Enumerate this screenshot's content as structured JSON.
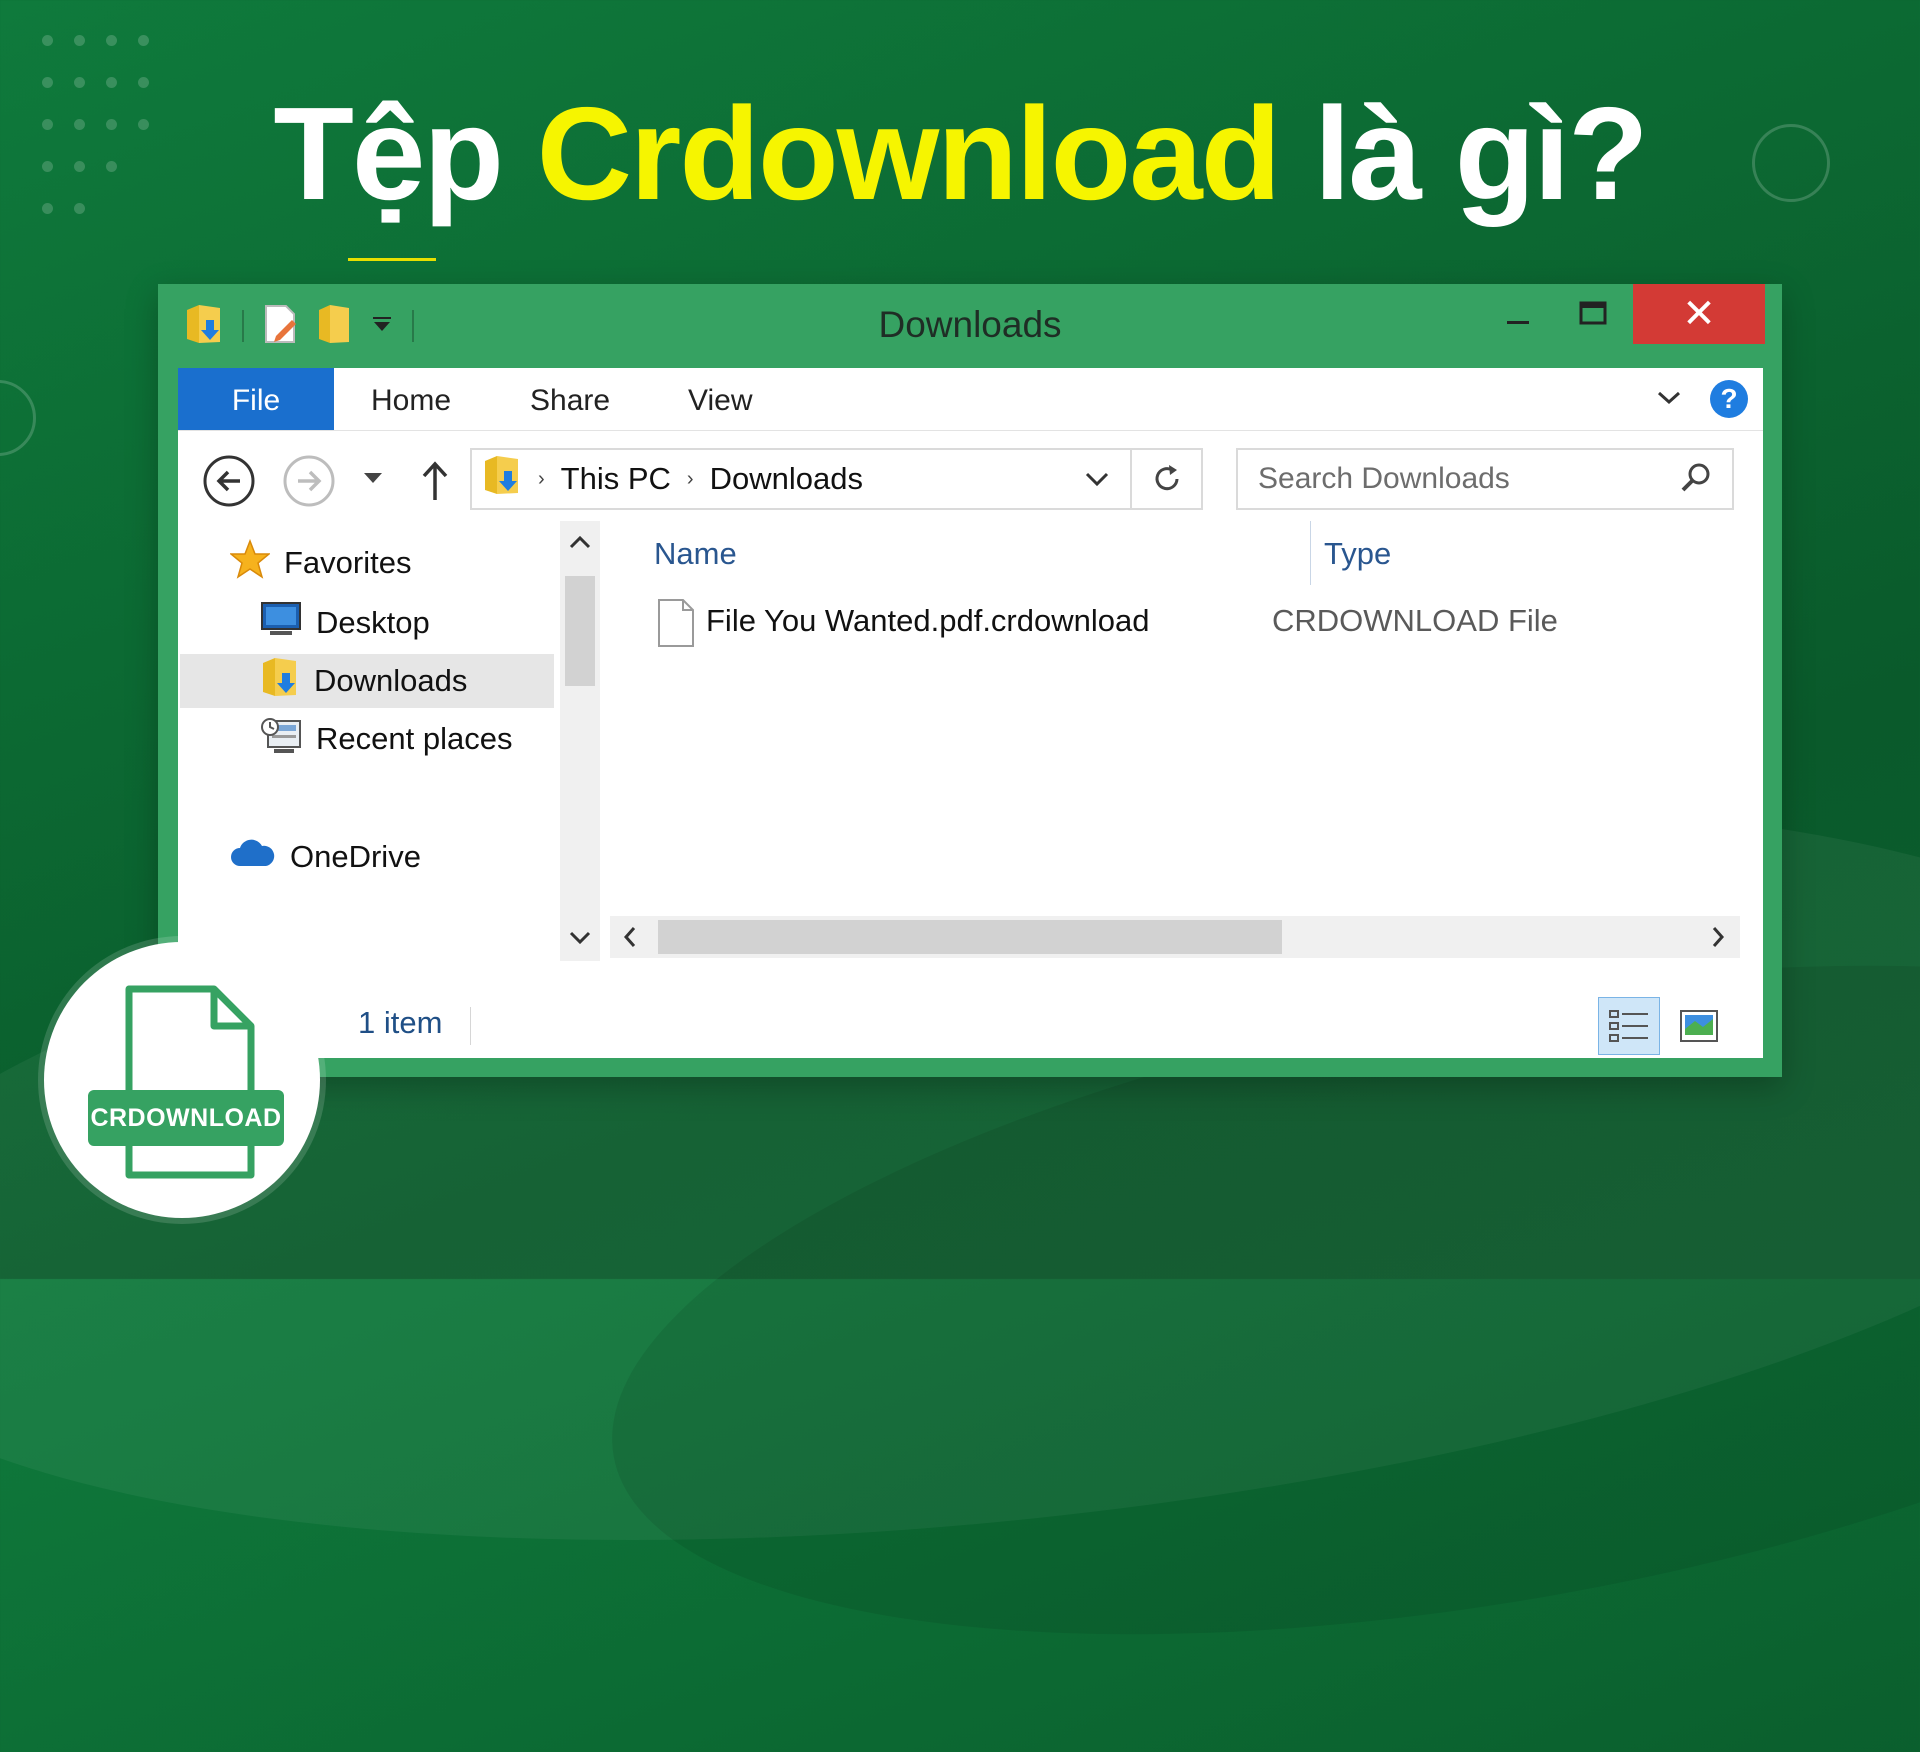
{
  "headline": {
    "part1": "Tệp ",
    "highlight": "Crdownload",
    "part2": " là gì?"
  },
  "window": {
    "title": "Downloads",
    "close_glyph": "✕"
  },
  "ribbon": {
    "tabs": [
      "File",
      "Home",
      "Share",
      "View"
    ],
    "help_glyph": "?"
  },
  "address": {
    "crumbs": [
      "This PC",
      "Downloads"
    ],
    "separator": "›"
  },
  "search": {
    "placeholder": "Search Downloads"
  },
  "nav": {
    "favorites": "Favorites",
    "items": [
      "Desktop",
      "Downloads",
      "Recent places"
    ],
    "onedrive": "OneDrive"
  },
  "columns": {
    "name": "Name",
    "type": "Type"
  },
  "files": [
    {
      "name": "File You Wanted.pdf.crdownload",
      "type": "CRDOWNLOAD File"
    }
  ],
  "status": {
    "count": "1 item"
  },
  "badge": {
    "label": "CRDOWNLOAD"
  },
  "colors": {
    "background": "#0c6a33",
    "window_frame": "#36a262",
    "highlight_text": "#f6f500",
    "file_tab": "#1a6fce",
    "close_button": "#d33a35"
  },
  "icons": [
    "folder-download-icon",
    "new-file-icon",
    "new-folder-icon",
    "customize-qat-icon",
    "back-arrow-icon",
    "forward-arrow-icon",
    "recent-locations-icon",
    "up-arrow-icon",
    "refresh-icon",
    "search-icon",
    "star-icon",
    "desktop-icon",
    "recent-places-icon",
    "cloud-icon",
    "document-icon",
    "details-view-icon",
    "large-icons-view-icon"
  ]
}
